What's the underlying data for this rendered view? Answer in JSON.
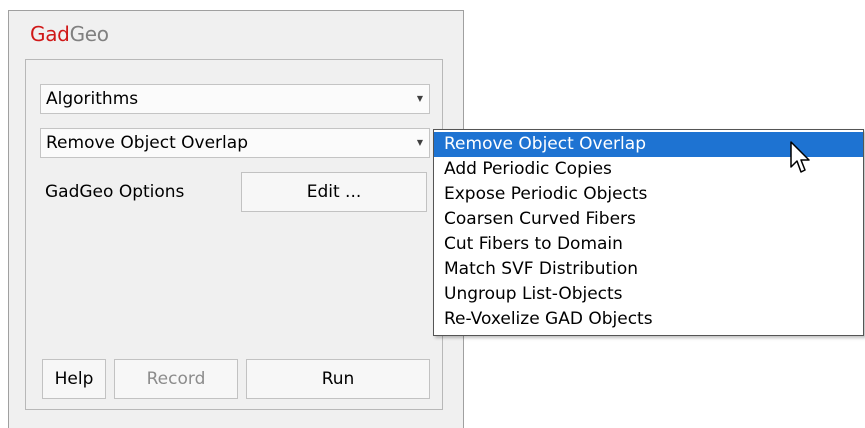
{
  "app": {
    "title_red": "Gad",
    "title_gray": "Geo"
  },
  "category_combo": {
    "value": "Algorithms"
  },
  "algorithm_combo": {
    "value": "Remove Object Overlap"
  },
  "options": {
    "label": "GadGeo Options",
    "edit_label": "Edit ..."
  },
  "footer": {
    "help_label": "Help",
    "record_label": "Record",
    "run_label": "Run"
  },
  "dropdown": {
    "items": [
      "Remove Object Overlap",
      "Add Periodic Copies",
      "Expose Periodic Objects",
      "Coarsen Curved Fibers",
      "Cut Fibers to Domain",
      "Match SVF Distribution",
      "Ungroup List-Objects",
      "Re-Voxelize GAD Objects"
    ],
    "selected_index": 0
  },
  "colors": {
    "brand_red": "#d01818",
    "brand_gray": "#808080",
    "selection_blue": "#1e73d2"
  },
  "icons": {
    "combo_arrow": "chevron-down-icon",
    "cursor": "mouse-pointer-icon"
  }
}
